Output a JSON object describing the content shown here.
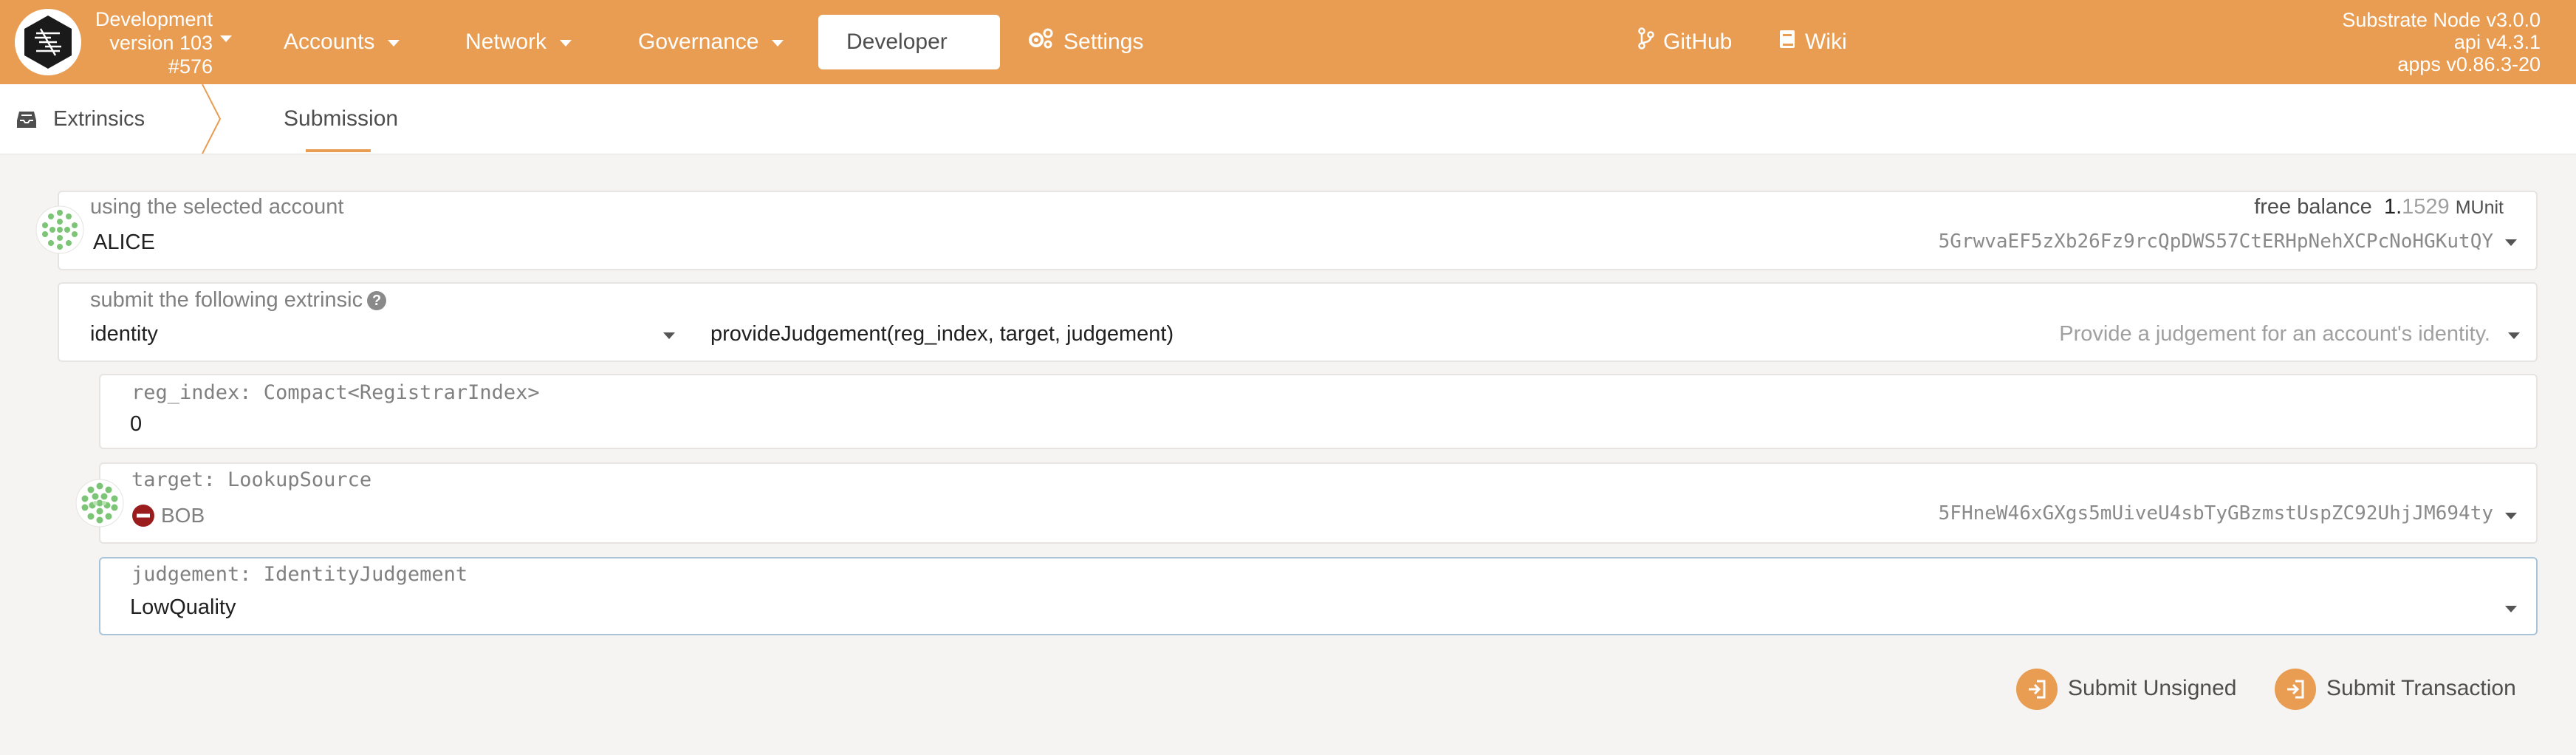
{
  "header": {
    "chain_name": "Development",
    "chain_version": "version 103",
    "block": "#576",
    "nav": [
      {
        "label": "Accounts"
      },
      {
        "label": "Network"
      },
      {
        "label": "Governance"
      },
      {
        "label": "Developer"
      },
      {
        "label": "Settings"
      },
      {
        "label": "GitHub"
      },
      {
        "label": "Wiki"
      }
    ],
    "node_version": "Substrate Node v3.0.0",
    "api_version": "api v4.3.1",
    "apps_version": "apps v0.86.3-20"
  },
  "tabs": {
    "section": "Extrinsics",
    "active": "Submission"
  },
  "account": {
    "label": "using the selected account",
    "name": "ALICE",
    "balance_label": "free balance",
    "balance_int": "1.",
    "balance_dec": "1529",
    "balance_unit": "MUnit",
    "address": "5GrwvaEF5zXb26Fz9rcQpDWS57CtERHpNehXCPcNoHGKutQY"
  },
  "extrinsic": {
    "label": "submit the following extrinsic",
    "help": "?",
    "module": "identity",
    "call": "provideJudgement(reg_index, target, judgement)",
    "description": "Provide a judgement for an account's identity."
  },
  "params": {
    "reg_index": {
      "label": "reg_index: Compact<RegistrarIndex>",
      "value": "0"
    },
    "target": {
      "label": "target: LookupSource",
      "name": "BOB",
      "address": "5FHneW46xGXgs5mUiveU4sbTyGBzmstUspZC92UhjJM694ty"
    },
    "judgement": {
      "label": "judgement: IdentityJudgement",
      "value": "LowQuality"
    }
  },
  "actions": {
    "unsigned": "Submit Unsigned",
    "signed": "Submit Transaction"
  },
  "colors": {
    "accent": "#e89d52",
    "danger": "#9b1c1c",
    "identicon": "#7cc576"
  }
}
